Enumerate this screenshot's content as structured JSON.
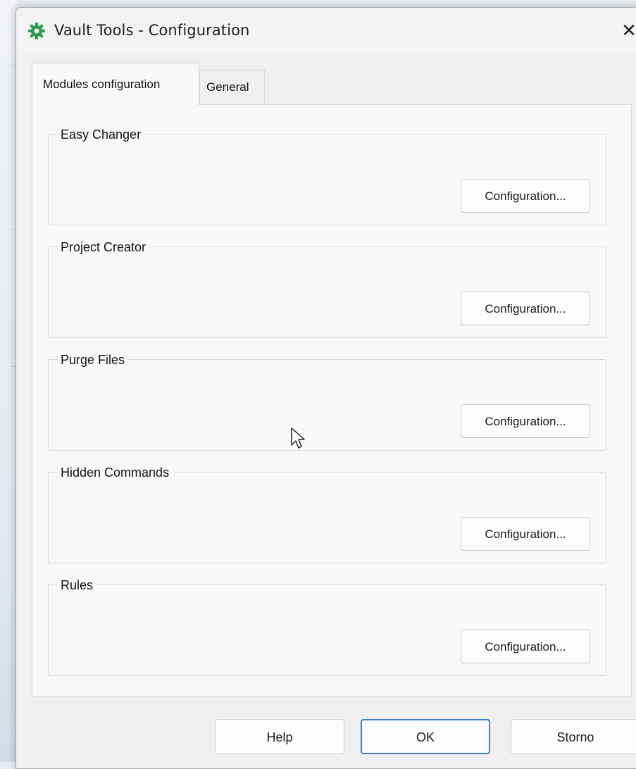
{
  "window": {
    "title": "Vault Tools - Configuration",
    "icon": "gear-icon",
    "close_glyph": "✕"
  },
  "tabs": [
    {
      "label": "Modules configuration",
      "active": true
    },
    {
      "label": "General",
      "active": false
    }
  ],
  "groups": [
    {
      "title": "Easy Changer",
      "button": "Configuration..."
    },
    {
      "title": "Project Creator",
      "button": "Configuration..."
    },
    {
      "title": "Purge Files",
      "button": "Configuration..."
    },
    {
      "title": "Hidden Commands",
      "button": "Configuration..."
    },
    {
      "title": "Rules",
      "button": "Configuration..."
    }
  ],
  "footer": {
    "help": "Help",
    "ok": "OK",
    "cancel": "Storno"
  },
  "colors": {
    "accent": "#3b7fc4",
    "icon_green": "#2e9a4f"
  }
}
